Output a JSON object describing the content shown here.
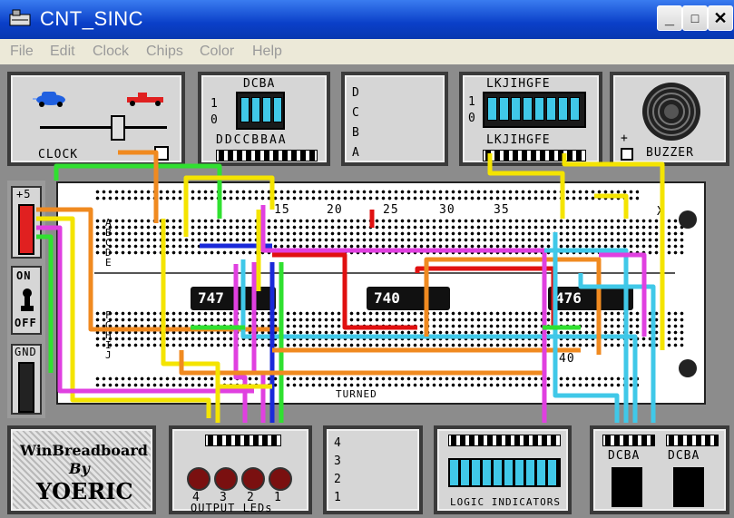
{
  "window": {
    "title": "CNT_SINC",
    "minimize": "_",
    "maximize": "□",
    "close": "✕"
  },
  "menu": [
    "File",
    "Edit",
    "Clock",
    "Chips",
    "Color",
    "Help"
  ],
  "clock": {
    "label": "CLOCK"
  },
  "dip_switch_small": {
    "header": "DCBA",
    "one": "1",
    "zero": "0",
    "footer": "DDCCBBAA"
  },
  "inputs_column": {
    "letters": [
      "D",
      "C",
      "B",
      "A"
    ]
  },
  "dip_switch_large": {
    "header": "LKJIHGFE",
    "one": "1",
    "zero": "0",
    "footer": "LKJIHGFE"
  },
  "buzzer": {
    "label": "BUZZER",
    "plus": "+"
  },
  "power": {
    "plus5": "+5",
    "on": "ON",
    "off": "OFF",
    "gnd": "GND"
  },
  "breadboard": {
    "column_numbers": [
      "15",
      "20",
      "25",
      "30",
      "35",
      "40"
    ],
    "row_letters_top": [
      "A",
      "B",
      "C",
      "D",
      "E"
    ],
    "row_letters_bottom": [
      "F",
      "G",
      "H",
      "I",
      "J"
    ],
    "x_label": "X",
    "chips": [
      "747",
      "740",
      "476"
    ],
    "footer_text": "TURNED"
  },
  "credits": {
    "line1": "WinBreadboard",
    "line2": "By",
    "line3": "YOERIC"
  },
  "output_leds": {
    "label": "OUTPUT LEDs",
    "numbers": [
      "4",
      "3",
      "2",
      "1"
    ]
  },
  "seven_segment": {
    "numbers": [
      "4",
      "3",
      "2",
      "1"
    ]
  },
  "logic_indicators": {
    "label": "LOGIC INDICATORS"
  },
  "outputs_right": {
    "group1": "DCBA",
    "group2": "DCBA"
  },
  "colors": {
    "title_blue": "#0a4fd8",
    "cyan": "#40c8e8",
    "wire_yellow": "#f4e400",
    "wire_orange": "#f08a20",
    "wire_magenta": "#e040e0",
    "wire_green": "#30e030",
    "wire_red": "#e01010",
    "wire_blue": "#1a2ad8"
  }
}
